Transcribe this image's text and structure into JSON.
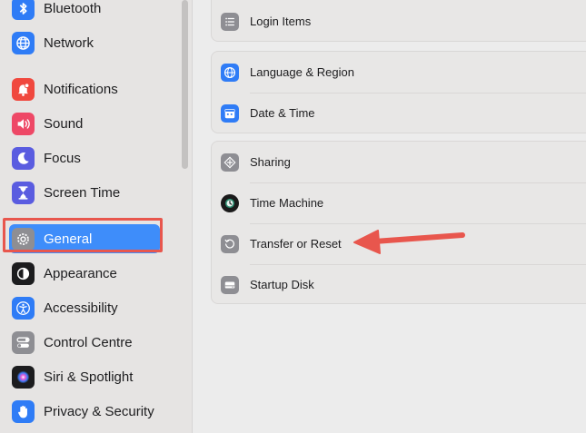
{
  "sidebar": {
    "items": [
      {
        "label": "Bluetooth",
        "icon": "bluetooth-icon",
        "color": "#2f7cf6"
      },
      {
        "label": "Network",
        "icon": "globe-icon",
        "color": "#2f7cf6"
      },
      {
        "label": "Notifications",
        "icon": "bell-icon",
        "color": "#f0483e"
      },
      {
        "label": "Sound",
        "icon": "speaker-icon",
        "color": "#ee4866"
      },
      {
        "label": "Focus",
        "icon": "moon-icon",
        "color": "#5a5ce0"
      },
      {
        "label": "Screen Time",
        "icon": "hourglass-icon",
        "color": "#5a5ce0"
      },
      {
        "label": "General",
        "icon": "gear-icon",
        "color": "#8e8e93",
        "selected": true
      },
      {
        "label": "Appearance",
        "icon": "appearance-icon",
        "color": "#1c1c1e"
      },
      {
        "label": "Accessibility",
        "icon": "accessibility-icon",
        "color": "#2f7cf6"
      },
      {
        "label": "Control Centre",
        "icon": "toggles-icon",
        "color": "#8e8e93"
      },
      {
        "label": "Siri & Spotlight",
        "icon": "siri-icon",
        "color": "#1c1c1e"
      },
      {
        "label": "Privacy & Security",
        "icon": "hand-icon",
        "color": "#2f7cf6"
      }
    ]
  },
  "main": {
    "groups": [
      {
        "rows": [
          {
            "label": "Login Items",
            "icon": "list-icon",
            "color": "#8e8e93"
          }
        ]
      },
      {
        "rows": [
          {
            "label": "Language & Region",
            "icon": "globe-icon",
            "color": "#2f7cf6"
          },
          {
            "label": "Date & Time",
            "icon": "calendar-icon",
            "color": "#2f7cf6"
          }
        ]
      },
      {
        "rows": [
          {
            "label": "Sharing",
            "icon": "sharing-icon",
            "color": "#8e8e93"
          },
          {
            "label": "Time Machine",
            "icon": "time-machine-icon",
            "color": "#1f6f5e"
          },
          {
            "label": "Transfer or Reset",
            "icon": "reset-icon",
            "color": "#8e8e93"
          },
          {
            "label": "Startup Disk",
            "icon": "disk-icon",
            "color": "#8e8e93"
          }
        ]
      }
    ]
  },
  "annotation": {
    "color": "#e8564d"
  }
}
